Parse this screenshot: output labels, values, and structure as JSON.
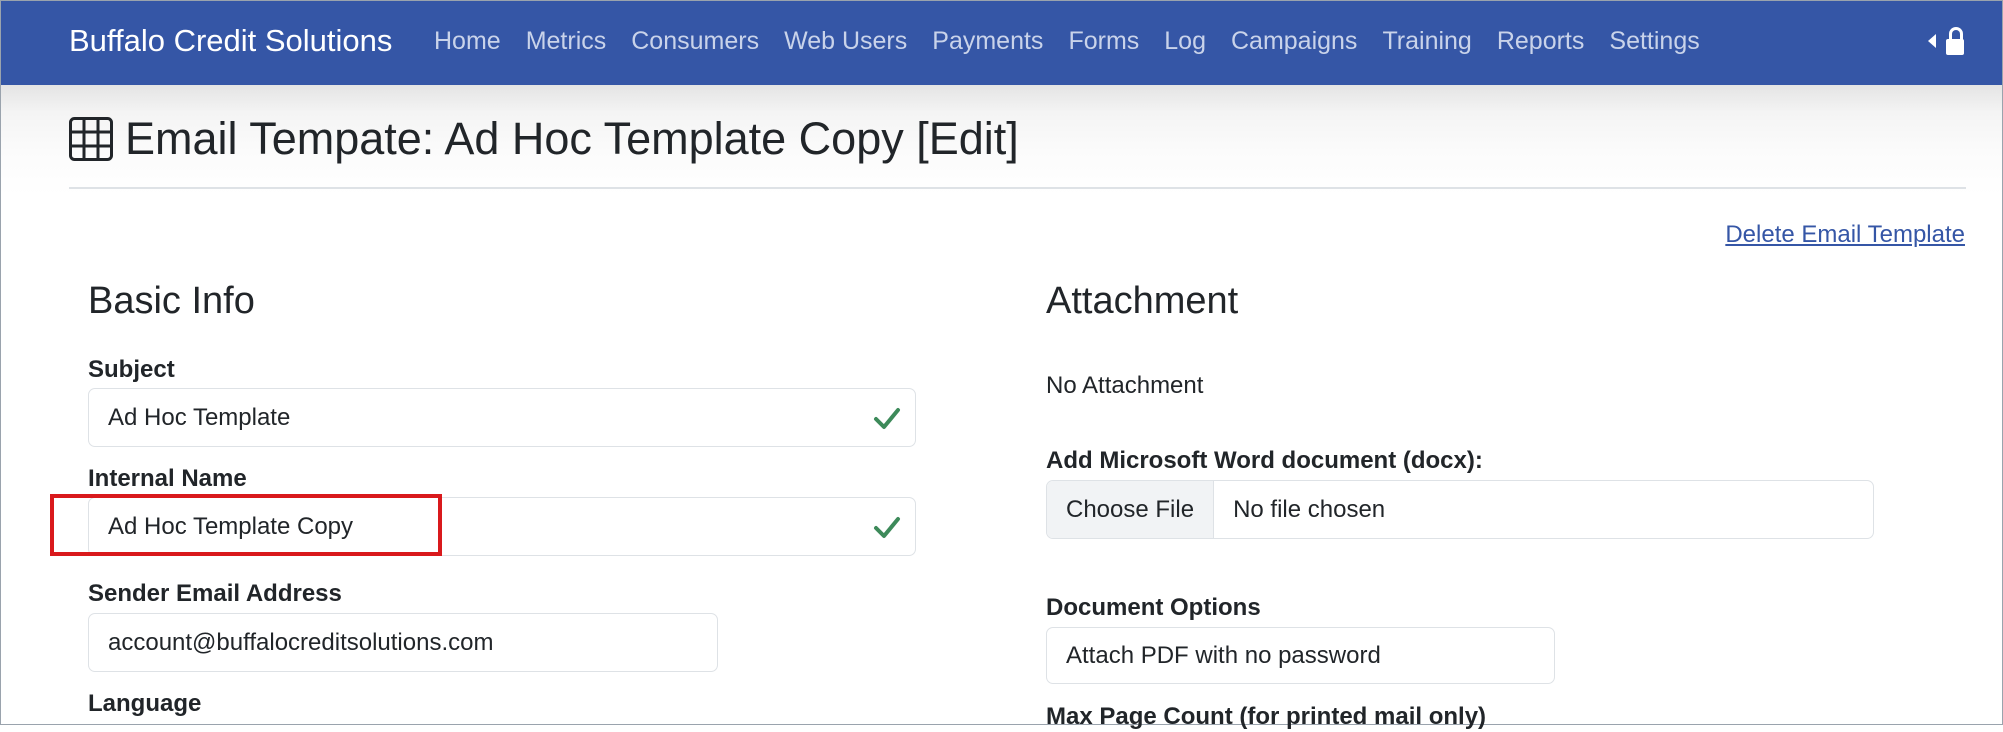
{
  "navbar": {
    "brand": "Buffalo Credit Solutions",
    "links": [
      "Home",
      "Metrics",
      "Consumers",
      "Web Users",
      "Payments",
      "Forms",
      "Log",
      "Campaigns",
      "Training",
      "Reports",
      "Settings"
    ]
  },
  "header": {
    "title": "Email Tempate: Ad Hoc Template Copy [Edit]",
    "title_icon": "table-icon"
  },
  "actions": {
    "delete_label": "Delete Email Template"
  },
  "basic_info": {
    "heading": "Basic Info",
    "subject_label": "Subject",
    "subject_value": "Ad Hoc Template",
    "internal_name_label": "Internal Name",
    "internal_name_value": "Ad Hoc Template Copy",
    "sender_label": "Sender Email Address",
    "sender_value": "account@buffalocreditsolutions.com",
    "language_label": "Language"
  },
  "attachment": {
    "heading": "Attachment",
    "status": "No Attachment",
    "word_label": "Add Microsoft Word document (docx):",
    "choose_file": "Choose File",
    "no_file": "No file chosen",
    "doc_options_label": "Document Options",
    "doc_options_value": "Attach PDF with no password",
    "max_page_label": "Max Page Count (for printed mail only)"
  },
  "colors": {
    "navbar": "#3556a6",
    "valid_check": "#3d8a5a",
    "highlight": "#d9191c"
  }
}
